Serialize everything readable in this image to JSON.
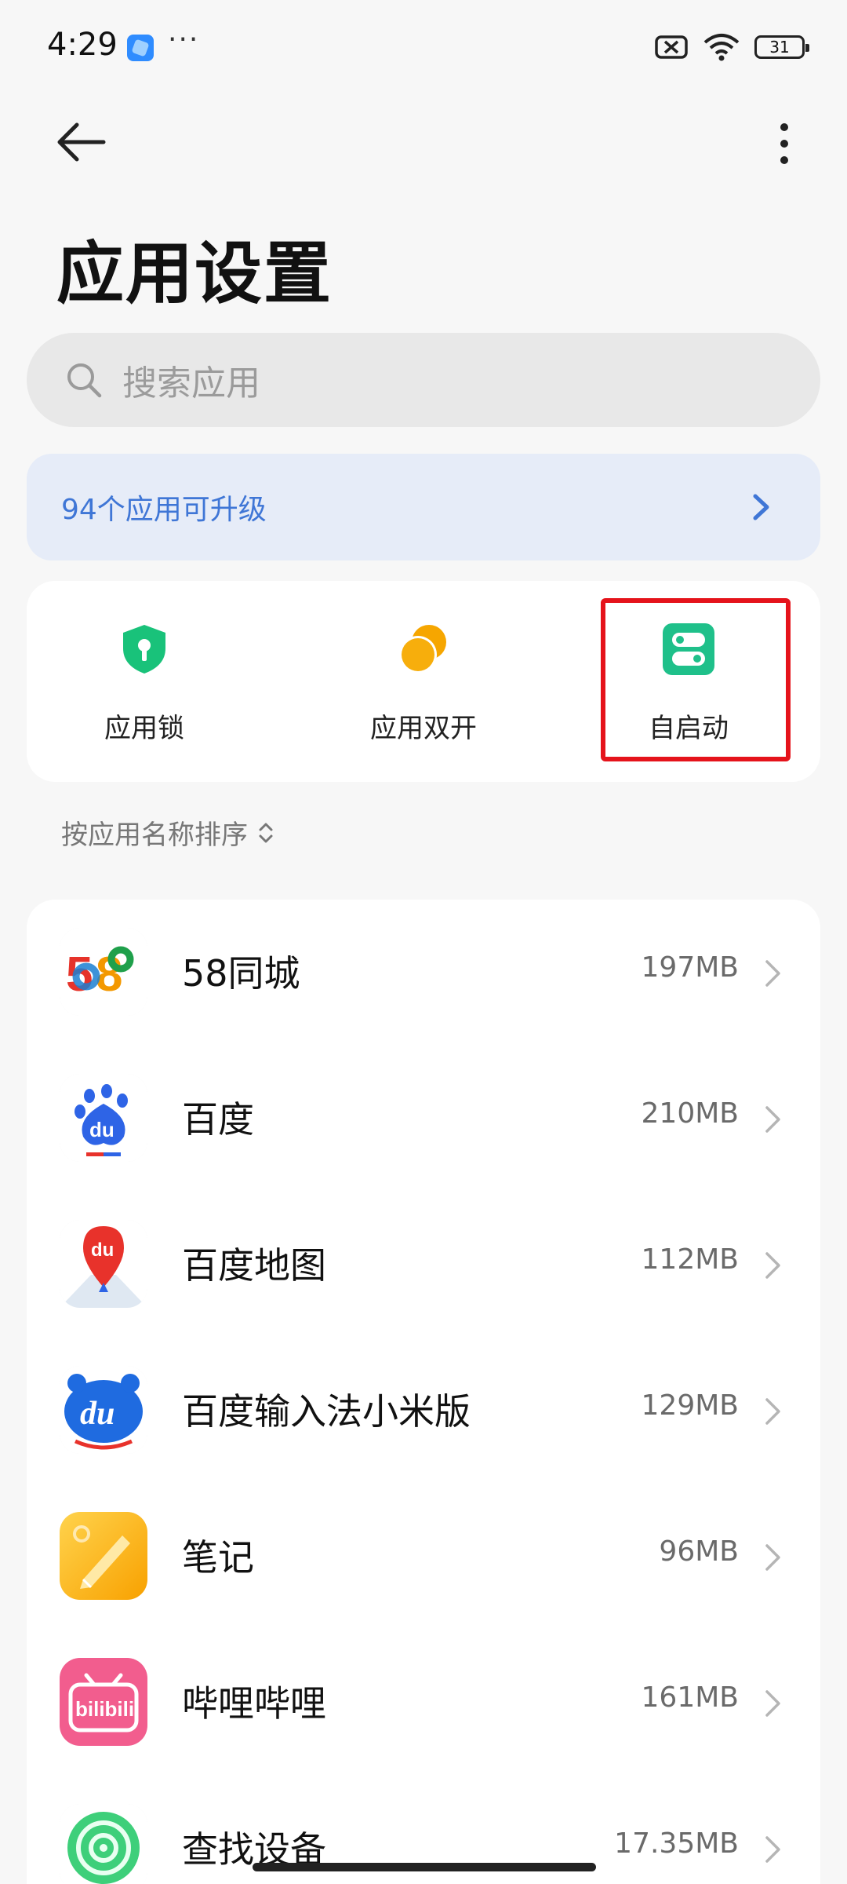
{
  "status": {
    "time": "4:29",
    "more": "···",
    "battery": "31",
    "icons": [
      "app-notification-icon",
      "sim-off-icon",
      "wifi-icon",
      "battery-icon"
    ]
  },
  "top_bar": {
    "back_icon": "back-arrow-icon",
    "menu_icon": "more-vertical-icon"
  },
  "title": "应用设置",
  "search": {
    "placeholder": "搜索应用"
  },
  "upgrade": {
    "text": "94个应用可升级",
    "accent": "#3f76d6"
  },
  "quick_actions": [
    {
      "label": "应用锁",
      "icon": "shield-lock-icon",
      "color": "#19c27a"
    },
    {
      "label": "应用双开",
      "icon": "dual-app-icon",
      "color": "#f6a600"
    },
    {
      "label": "自启动",
      "icon": "autostart-icon",
      "color": "#1fc08a"
    }
  ],
  "highlight_color": "#e5131b",
  "sort": {
    "label": "按应用名称排序"
  },
  "apps": [
    {
      "name": "58同城",
      "size": "197MB",
      "icon": "58-tongcheng-icon"
    },
    {
      "name": "百度",
      "size": "210MB",
      "icon": "baidu-icon"
    },
    {
      "name": "百度地图",
      "size": "112MB",
      "icon": "baidu-map-icon"
    },
    {
      "name": "百度输入法小米版",
      "size": "129MB",
      "icon": "baidu-input-icon"
    },
    {
      "name": "笔记",
      "size": "96MB",
      "icon": "notes-icon"
    },
    {
      "name": "哔哩哔哩",
      "size": "161MB",
      "icon": "bilibili-icon"
    },
    {
      "name": "查找设备",
      "size": "17.35MB",
      "icon": "find-device-icon"
    }
  ]
}
